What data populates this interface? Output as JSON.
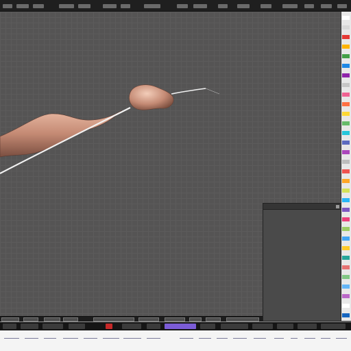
{
  "menubar": {
    "items": [
      "",
      "",
      "",
      "",
      "",
      "",
      "",
      "",
      "",
      "",
      "",
      "",
      "",
      "",
      "",
      "",
      ""
    ]
  },
  "viewport": {
    "grid": true
  },
  "panel": {
    "title": ""
  },
  "palette": {
    "colors": [
      "#ffffff",
      "#d9d9d9",
      "#e53935",
      "#ffb300",
      "#43a047",
      "#1e88e5",
      "#8e24aa",
      "#c6c6c6",
      "#f06292",
      "#ff7043",
      "#fdd835",
      "#66bb6a",
      "#26c6da",
      "#5c6bc0",
      "#ab47bc",
      "#bdbdbd",
      "#ef5350",
      "#ffa726",
      "#d4e157",
      "#29b6f6",
      "#7e57c2",
      "#ec407a",
      "#9ccc65",
      "#42a5f5",
      "#ffca28",
      "#26a69a",
      "#e57373",
      "#81c784",
      "#64b5f6",
      "#ba68c8",
      "#ffffff",
      "#1565c0"
    ]
  },
  "colors": {
    "accent": "#7b5cd6",
    "model": "#c98d77",
    "background": "#555454"
  }
}
